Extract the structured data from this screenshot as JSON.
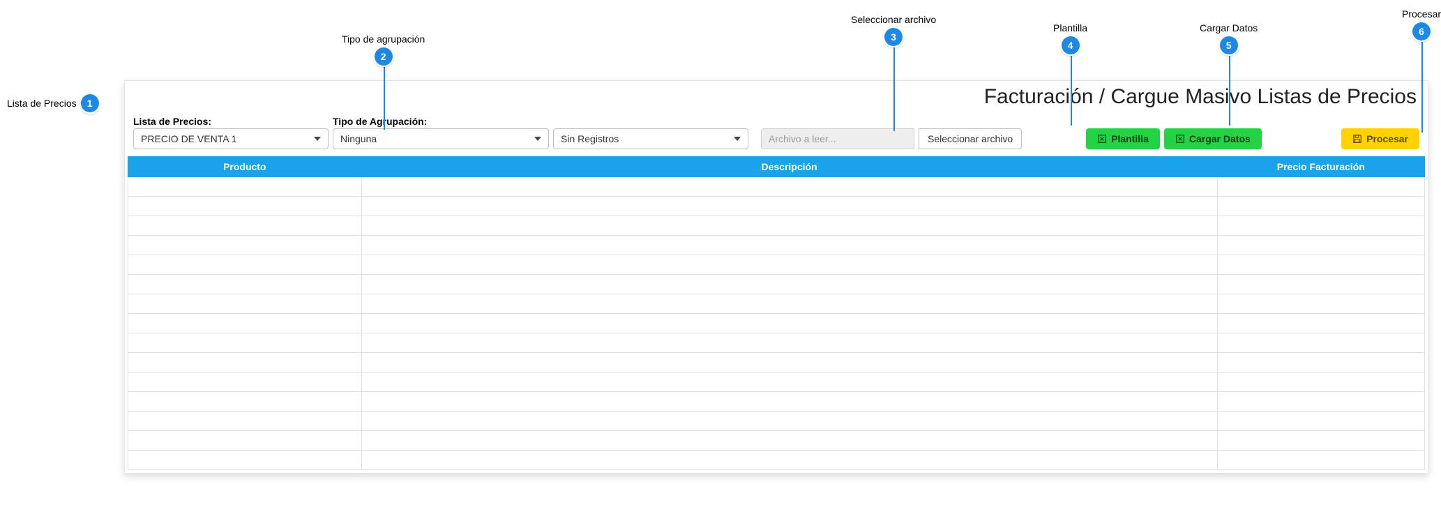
{
  "annotations": {
    "c1": {
      "label": "Lista de Precios",
      "num": "1"
    },
    "c2": {
      "label": "Tipo de agrupación",
      "num": "2"
    },
    "c3": {
      "label": "Seleccionar archivo",
      "num": "3"
    },
    "c4": {
      "label": "Plantilla",
      "num": "4"
    },
    "c5": {
      "label": "Cargar Datos",
      "num": "5"
    },
    "c6": {
      "label": "Procesar",
      "num": "6"
    }
  },
  "panel": {
    "title": "Facturación / Cargue Masivo Listas de Precios"
  },
  "filters": {
    "precio_label": "Lista de Precios:",
    "precio_value": "PRECIO DE VENTA 1",
    "agrup_label": "Tipo de Agrupación:",
    "agrup_value": "Ninguna",
    "reg_value": "Sin Registros",
    "file_placeholder": "Archivo a leer...",
    "file_button": "Seleccionar archivo"
  },
  "buttons": {
    "plantilla": "Plantilla",
    "cargar": "Cargar Datos",
    "procesar": "Procesar"
  },
  "grid": {
    "headers": {
      "producto": "Producto",
      "descripcion": "Descripción",
      "precio": "Precio Facturación"
    },
    "rows": [
      {
        "producto": "",
        "descripcion": "",
        "precio": ""
      },
      {
        "producto": "",
        "descripcion": "",
        "precio": ""
      },
      {
        "producto": "",
        "descripcion": "",
        "precio": ""
      },
      {
        "producto": "",
        "descripcion": "",
        "precio": ""
      },
      {
        "producto": "",
        "descripcion": "",
        "precio": ""
      },
      {
        "producto": "",
        "descripcion": "",
        "precio": ""
      },
      {
        "producto": "",
        "descripcion": "",
        "precio": ""
      },
      {
        "producto": "",
        "descripcion": "",
        "precio": ""
      },
      {
        "producto": "",
        "descripcion": "",
        "precio": ""
      },
      {
        "producto": "",
        "descripcion": "",
        "precio": ""
      },
      {
        "producto": "",
        "descripcion": "",
        "precio": ""
      },
      {
        "producto": "",
        "descripcion": "",
        "precio": ""
      },
      {
        "producto": "",
        "descripcion": "",
        "precio": ""
      },
      {
        "producto": "",
        "descripcion": "",
        "precio": ""
      },
      {
        "producto": "",
        "descripcion": "",
        "precio": ""
      }
    ]
  }
}
